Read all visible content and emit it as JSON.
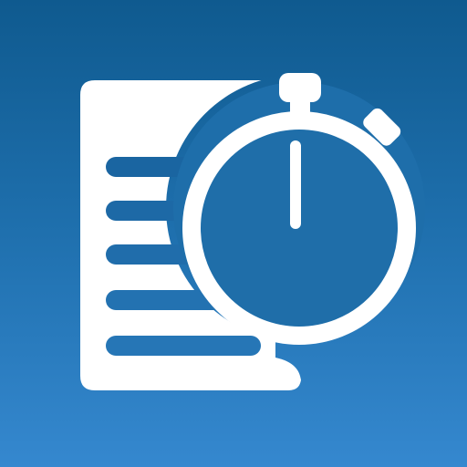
{
  "app_icon": {
    "icon_name": "document-stopwatch-icon",
    "colors": {
      "background_top": "#0f5a8f",
      "background_bottom": "#3588cf",
      "foreground": "#ffffff"
    },
    "document": {
      "icon_name": "document-icon",
      "line_count": 5
    },
    "stopwatch": {
      "icon_name": "stopwatch-icon",
      "hand_position": "12 o'clock"
    }
  }
}
